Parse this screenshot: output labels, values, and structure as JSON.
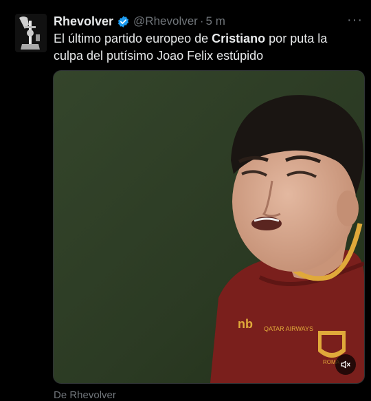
{
  "tweet": {
    "author_name": "Rhevolver",
    "handle": "@Rhevolver",
    "separator": "·",
    "time": "5 m",
    "more_label": "···",
    "text_part1": "El último partido europeo de ",
    "text_bold": "Cristiano",
    "text_part2": " por  puta la culpa del putísimo Joao Felix estúpido",
    "footer": "De Rhevolver"
  },
  "media": {
    "jersey_brand": "nb",
    "crest_label": "ROMA"
  },
  "icons": {
    "verified": "verified-badge-icon",
    "mute": "volume-muted-icon",
    "more": "more-options-icon"
  },
  "colors": {
    "background": "#000000",
    "text": "#e7e9ea",
    "muted": "#71767b",
    "verified": "#1d9bf0",
    "pitch": "#2b3a23",
    "jersey": "#7a1f1c",
    "collar": "#e0a93a"
  }
}
